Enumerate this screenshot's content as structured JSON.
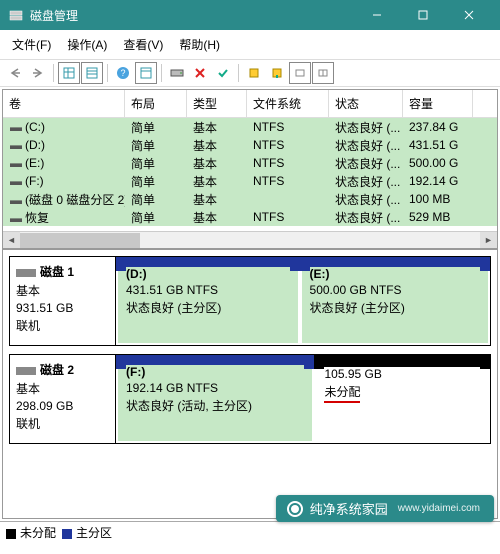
{
  "window": {
    "title": "磁盘管理"
  },
  "menu": {
    "file": "文件(F)",
    "action": "操作(A)",
    "view": "查看(V)",
    "help": "帮助(H)"
  },
  "columns": {
    "volume": "卷",
    "layout": "布局",
    "type": "类型",
    "filesystem": "文件系统",
    "status": "状态",
    "capacity": "容量"
  },
  "volumes": [
    {
      "name": "(C:)",
      "layout": "简单",
      "type": "基本",
      "fs": "NTFS",
      "status": "状态良好 (...",
      "cap": "237.84 G"
    },
    {
      "name": "(D:)",
      "layout": "简单",
      "type": "基本",
      "fs": "NTFS",
      "status": "状态良好 (...",
      "cap": "431.51 G"
    },
    {
      "name": "(E:)",
      "layout": "简单",
      "type": "基本",
      "fs": "NTFS",
      "status": "状态良好 (...",
      "cap": "500.00 G"
    },
    {
      "name": "(F:)",
      "layout": "简单",
      "type": "基本",
      "fs": "NTFS",
      "status": "状态良好 (...",
      "cap": "192.14 G"
    },
    {
      "name": "(磁盘 0 磁盘分区 2)",
      "layout": "简单",
      "type": "基本",
      "fs": "",
      "status": "状态良好 (...",
      "cap": "100 MB"
    },
    {
      "name": "恢复",
      "layout": "简单",
      "type": "基本",
      "fs": "NTFS",
      "status": "状态良好 (...",
      "cap": "529 MB"
    }
  ],
  "disks": {
    "d1": {
      "name": "磁盘 1",
      "type": "基本",
      "size": "931.51 GB",
      "state": "联机",
      "parts": {
        "p0": {
          "title": "(D:)",
          "line1": "431.51 GB NTFS",
          "line2": "状态良好 (主分区)"
        },
        "p1": {
          "title": "(E:)",
          "line1": "500.00 GB NTFS",
          "line2": "状态良好 (主分区)"
        }
      }
    },
    "d2": {
      "name": "磁盘 2",
      "type": "基本",
      "size": "298.09 GB",
      "state": "联机",
      "parts": {
        "p0": {
          "title": "(F:)",
          "line1": "192.14 GB NTFS",
          "line2": "状态良好 (活动, 主分区)"
        },
        "p1": {
          "title": "",
          "line1": "105.95 GB",
          "line2": "未分配"
        }
      }
    }
  },
  "legend": {
    "unallocated": "未分配",
    "primary": "主分区"
  },
  "watermark": {
    "main": "纯净系统家园",
    "sub": "www.yidaimei.com"
  }
}
